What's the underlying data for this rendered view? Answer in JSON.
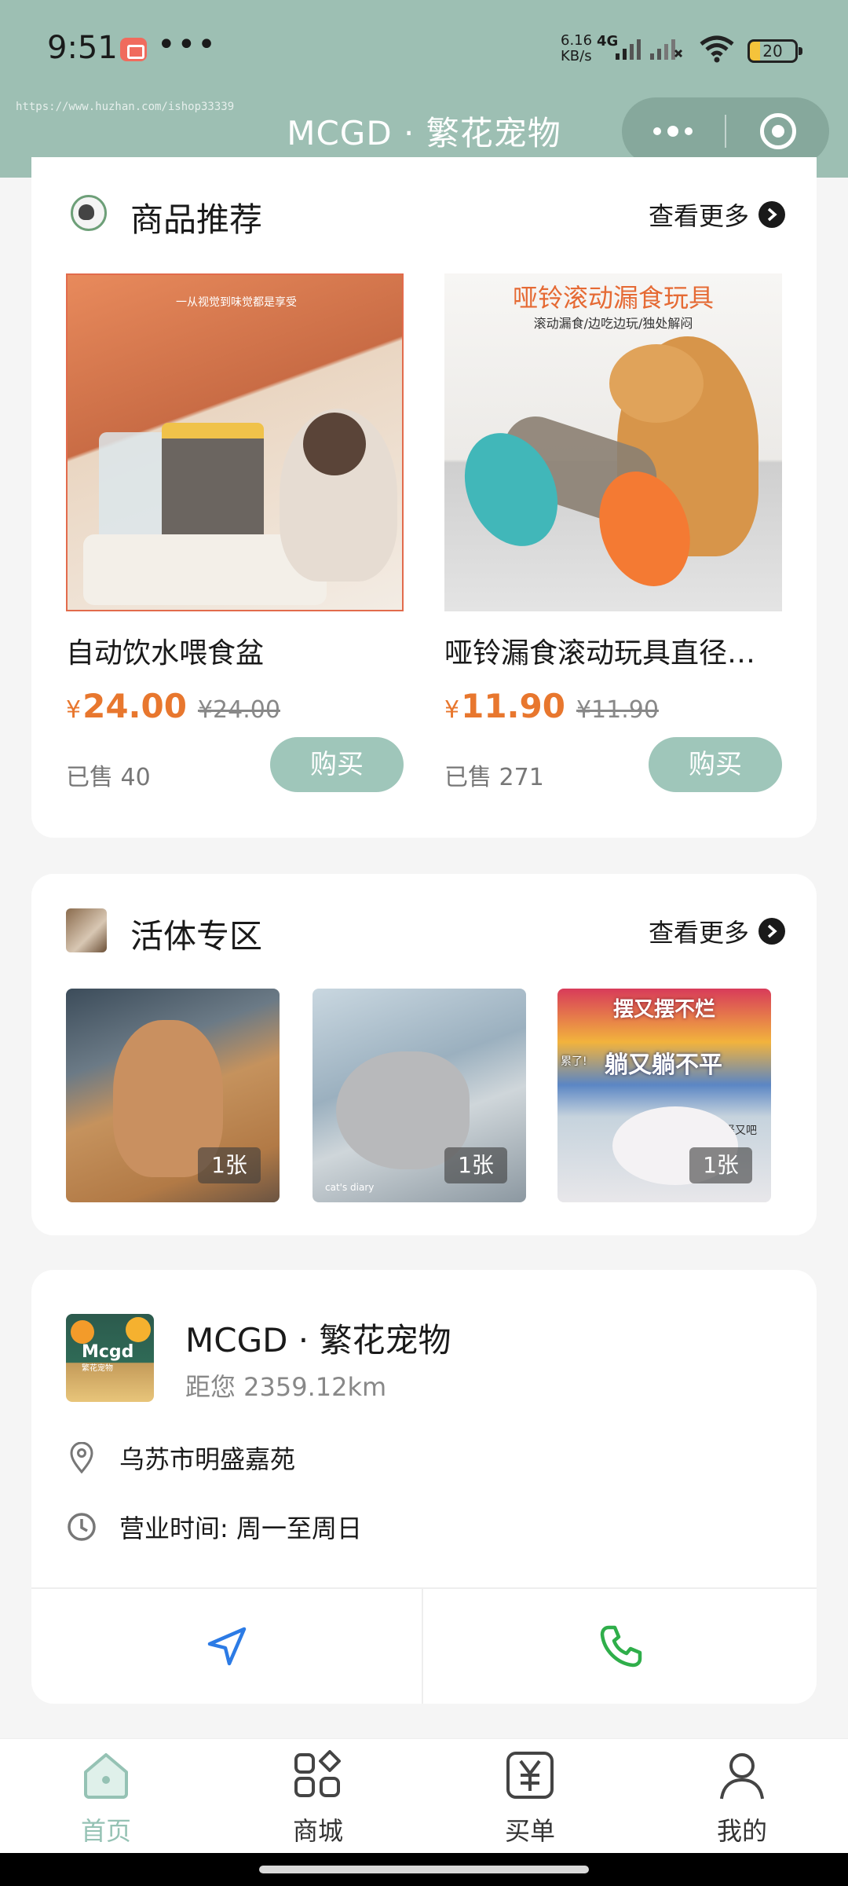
{
  "status_bar": {
    "time": "9:51",
    "more": "•••",
    "net_speed": "6.16\nKB/s",
    "net_type": "4G",
    "battery": "20"
  },
  "watermark": "https://www.huzhan.com/ishop33339",
  "nav": {
    "title": "MCGD · 繁花宠物"
  },
  "products": {
    "title": "商品推荐",
    "see_more": "查看更多",
    "items": [
      {
        "name": "自动饮水喂食盆",
        "currency": "¥",
        "price": "24.00",
        "old_price": "¥24.00",
        "sold": "已售 40",
        "buy": "购买",
        "img_caption": "一从视觉到味觉都是享受"
      },
      {
        "name": "哑铃漏食滚动玩具直径…",
        "currency": "¥",
        "price": "11.90",
        "old_price": "¥11.90",
        "sold": "已售 271",
        "buy": "购买",
        "img_caption": "哑铃滚动漏食玩具",
        "img_sub": "滚动漏食/边吃边玩/独处解闷"
      }
    ]
  },
  "live": {
    "title": "活体专区",
    "see_more": "查看更多",
    "items": [
      {
        "badge": "1张"
      },
      {
        "badge": "1张",
        "overlay": "cat's diary"
      },
      {
        "badge": "1张",
        "overlay_top": "摆又摆不烂",
        "overlay_small": "累了!",
        "overlay_main": "躺又躺不平",
        "overlay_corner": "竖又吧"
      }
    ]
  },
  "store": {
    "name": "MCGD · 繁花宠物",
    "distance": "距您 2359.12km",
    "address": "乌苏市明盛嘉苑",
    "hours": "营业时间: 周一至周日",
    "logo_text": "Mcgd",
    "logo_sub": "繁花宠物"
  },
  "tabbar": {
    "items": [
      {
        "label": "首页",
        "icon": "home-icon",
        "active": true
      },
      {
        "label": "商城",
        "icon": "grid-icon",
        "active": false
      },
      {
        "label": "买单",
        "icon": "yuan-icon",
        "active": false
      },
      {
        "label": "我的",
        "icon": "user-icon",
        "active": false
      }
    ]
  },
  "colors": {
    "header": "#9dbfb3",
    "accent_price": "#e8772e",
    "buy_button": "#9fc6ba",
    "tab_active": "#95c2b4",
    "nav_icon": "#2c7be5",
    "call_icon": "#2fae4a"
  }
}
